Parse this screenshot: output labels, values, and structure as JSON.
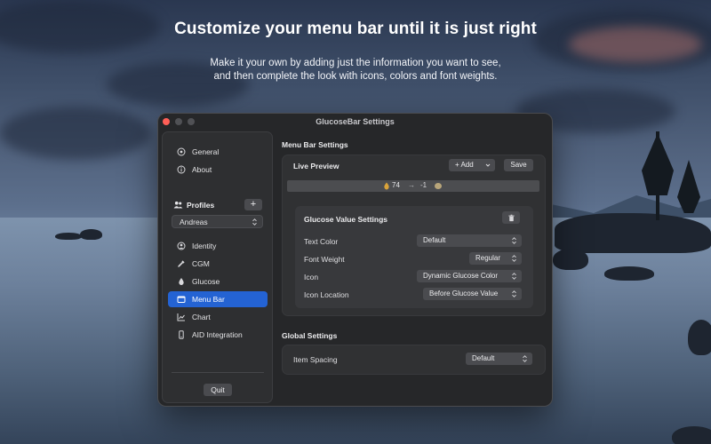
{
  "hero": {
    "title": "Customize your menu bar until it is just right",
    "subtitle_line1": "Make it your own by adding just the information you want to see,",
    "subtitle_line2": "and then complete the look with icons, colors and font weights."
  },
  "window": {
    "title": "GlucoseBar Settings"
  },
  "sidebar": {
    "top_items": [
      {
        "label": "General",
        "icon": "gear-icon"
      },
      {
        "label": "About",
        "icon": "info-icon"
      }
    ],
    "profiles_label": "Profiles",
    "add_profile_label": "+",
    "profile_selected": "Andreas",
    "items": [
      {
        "label": "Identity",
        "icon": "person-icon"
      },
      {
        "label": "CGM",
        "icon": "sensor-icon"
      },
      {
        "label": "Glucose",
        "icon": "drop-icon"
      },
      {
        "label": "Menu Bar",
        "icon": "menubar-icon",
        "active": true
      },
      {
        "label": "Chart",
        "icon": "chart-icon"
      },
      {
        "label": "AID Integration",
        "icon": "phone-icon"
      }
    ],
    "quit_label": "Quit"
  },
  "menu_bar_settings": {
    "title": "Menu Bar Settings",
    "live_preview_label": "Live Preview",
    "add_button_label": "+ Add",
    "save_button_label": "Save",
    "preview": {
      "value": "74",
      "arrow": "→",
      "delta": "-1"
    },
    "glucose_value_settings": {
      "title": "Glucose Value Settings",
      "rows": [
        {
          "label": "Text Color",
          "value": "Default"
        },
        {
          "label": "Font Weight",
          "value": "Regular"
        },
        {
          "label": "Icon",
          "value": "Dynamic Glucose Color"
        },
        {
          "label": "Icon Location",
          "value": "Before Glucose Value"
        }
      ]
    }
  },
  "global_settings": {
    "title": "Global Settings",
    "item_spacing_label": "Item Spacing",
    "item_spacing_value": "Default"
  },
  "colors": {
    "accent": "#2463d3",
    "close_button": "#ff5f57",
    "window_bg": "#262729"
  }
}
